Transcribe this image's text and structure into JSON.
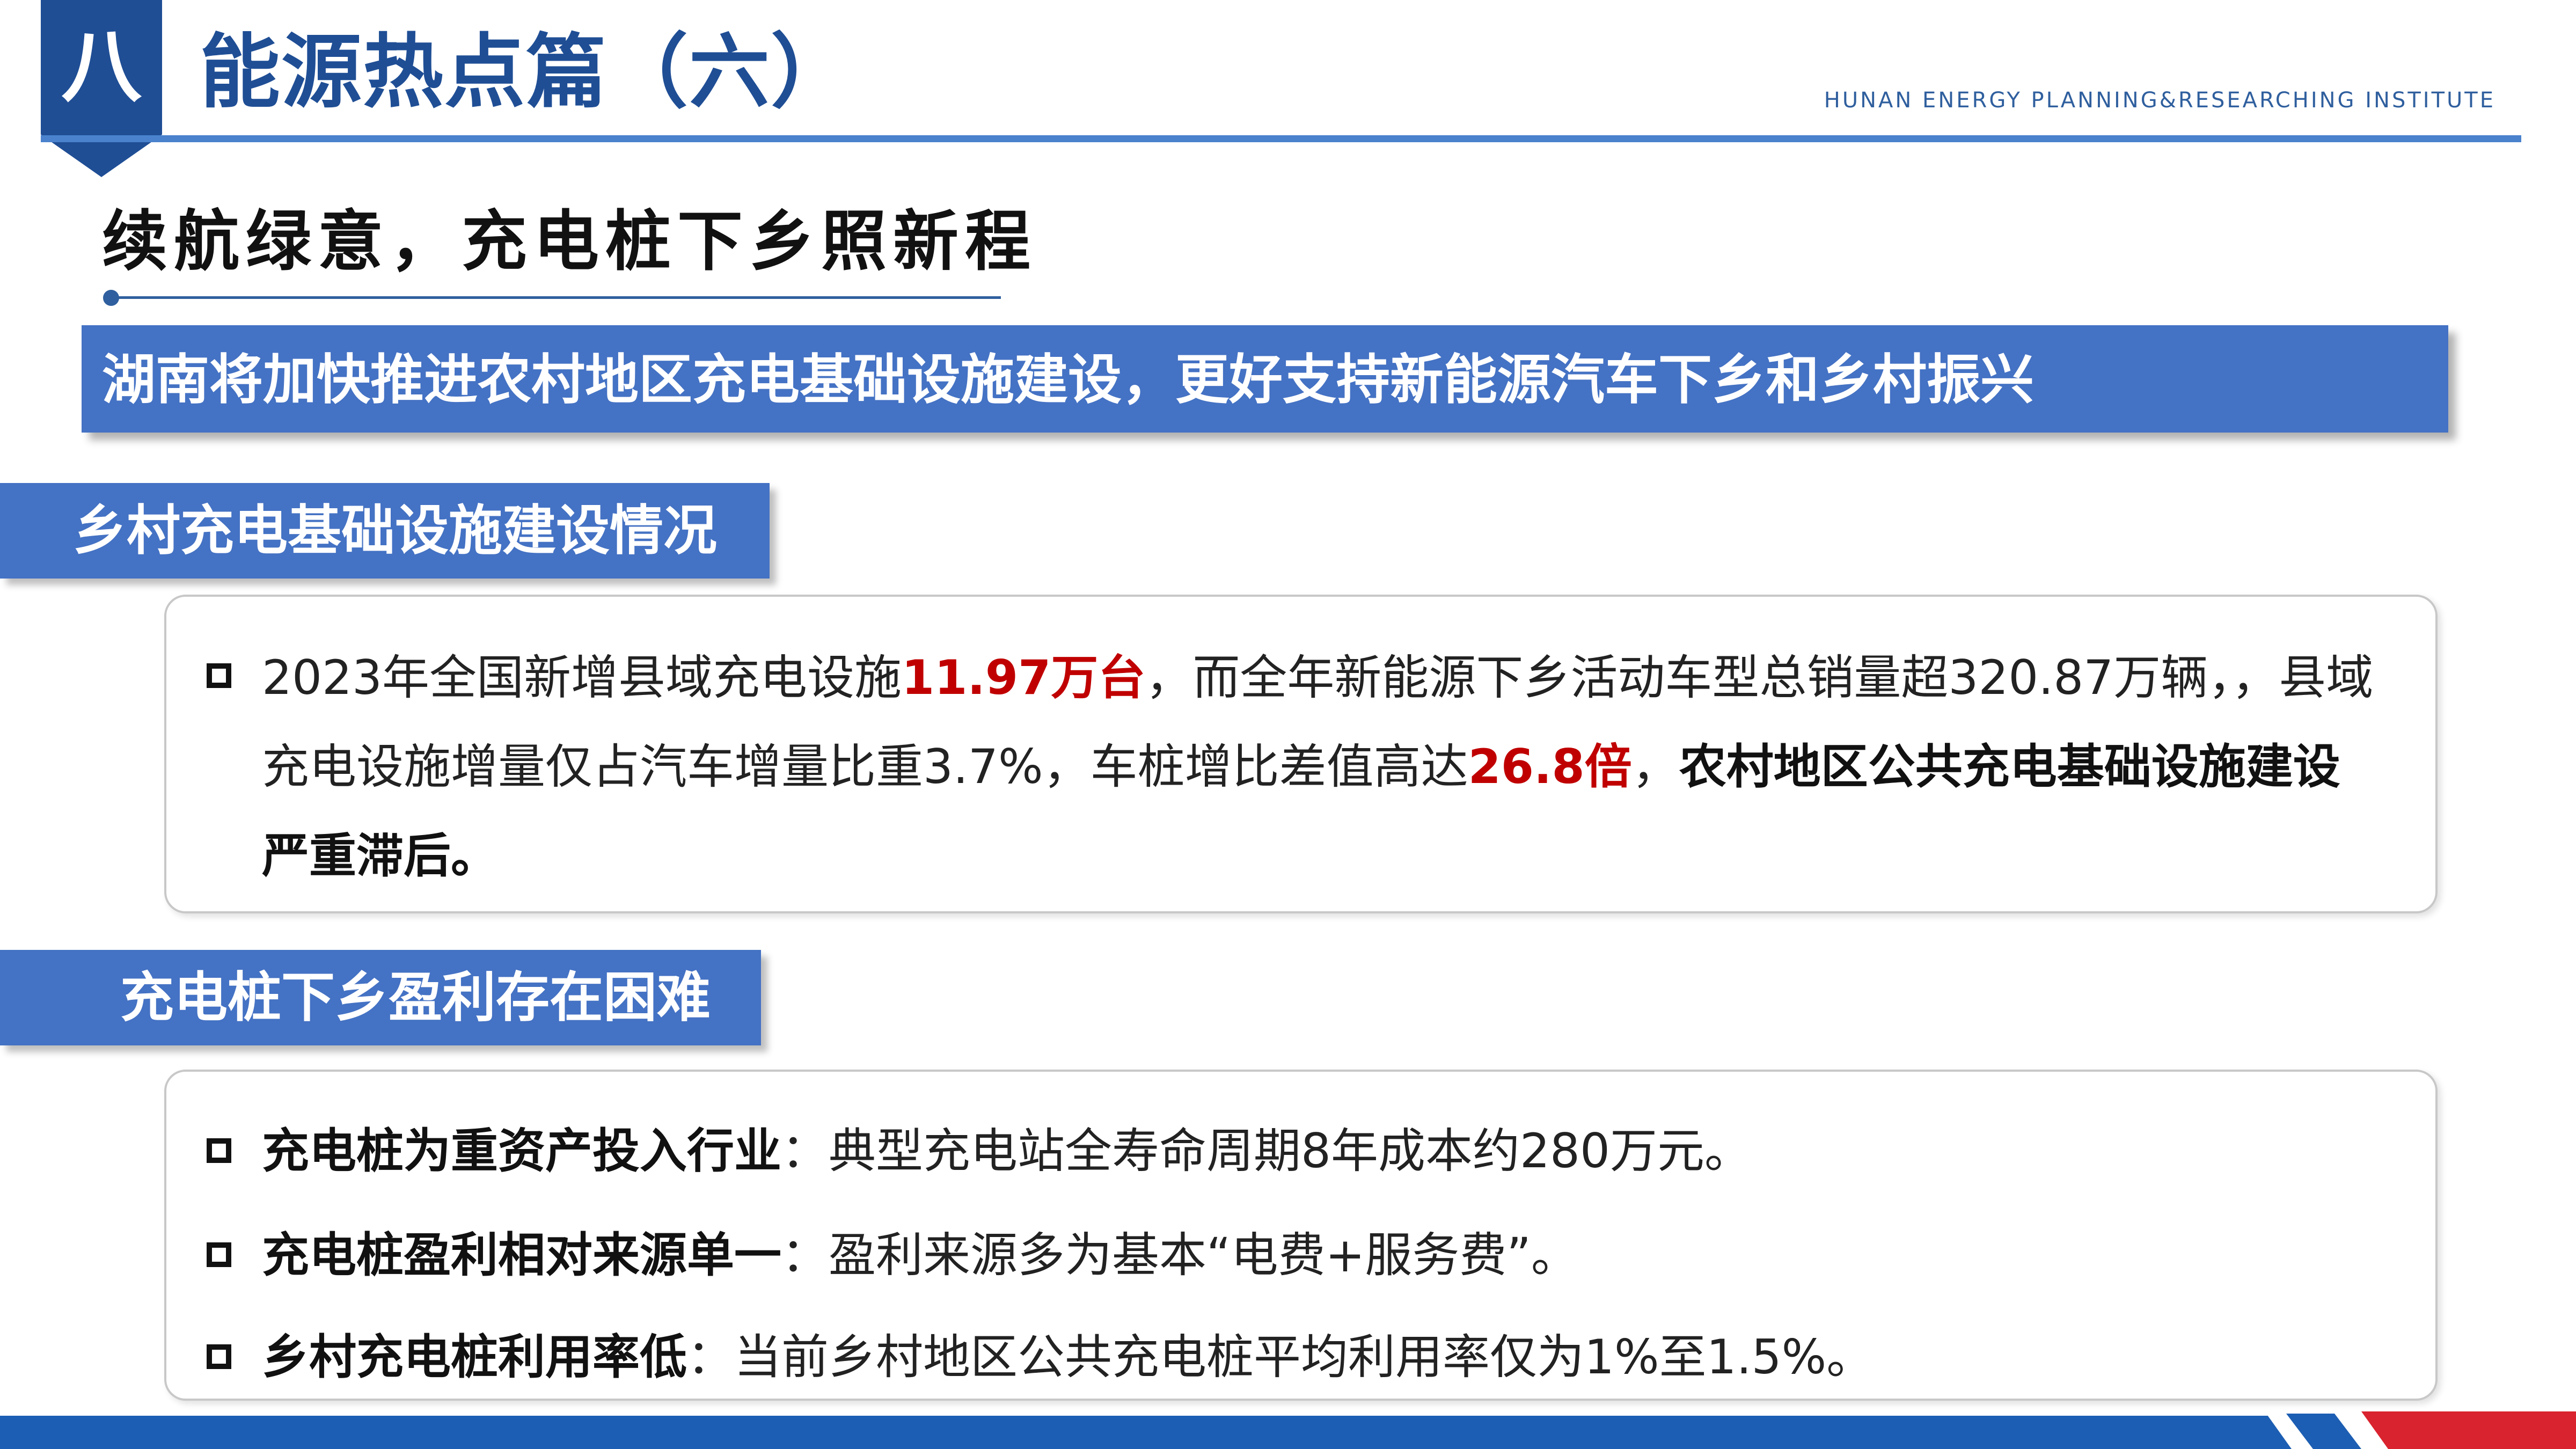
{
  "header": {
    "chapter_number": "八",
    "title": "能源热点篇（六）",
    "institute": "HUNAN ENERGY PLANNING&RESEARCHING INSTITUTE"
  },
  "subtitle": "续航绿意，充电桩下乡照新程",
  "banner": "湖南将加快推进农村地区充电基础设施建设，更好支持新能源汽车下乡和乡村振兴",
  "section1": {
    "label": "乡村充电基础设施建设情况",
    "p1": "2023年全国新增县域充电设施",
    "p1_highlight": "11.97万台",
    "p2": "，而全年新能源下乡活动车型总销量超320.87万辆，，县域充电设施增量仅占汽车增量比重3.7%，车桩增比差值高达",
    "p2_highlight": "26.8倍",
    "p3": "，",
    "p3_bold": "农村地区公共充电基础设施建设严重滞后。"
  },
  "section2": {
    "label": "充电桩下乡盈利存在困难",
    "items": [
      {
        "bold": "充电桩为重资产投入行业",
        "text": "：典型充电站全寿命周期8年成本约280万元。"
      },
      {
        "bold": "充电桩盈利相对来源单一",
        "text": "：盈利来源多为基本“电费+服务费”。"
      },
      {
        "bold": "乡村充电桩利用率低",
        "text": "：当前乡村地区公共充电桩平均利用率仅为1%至1.5%。"
      }
    ]
  },
  "colors": {
    "primary_dark": "#1f4e95",
    "primary": "#4472c4",
    "highlight_red": "#c00000",
    "footer_blue": "#1c5eb3"
  }
}
